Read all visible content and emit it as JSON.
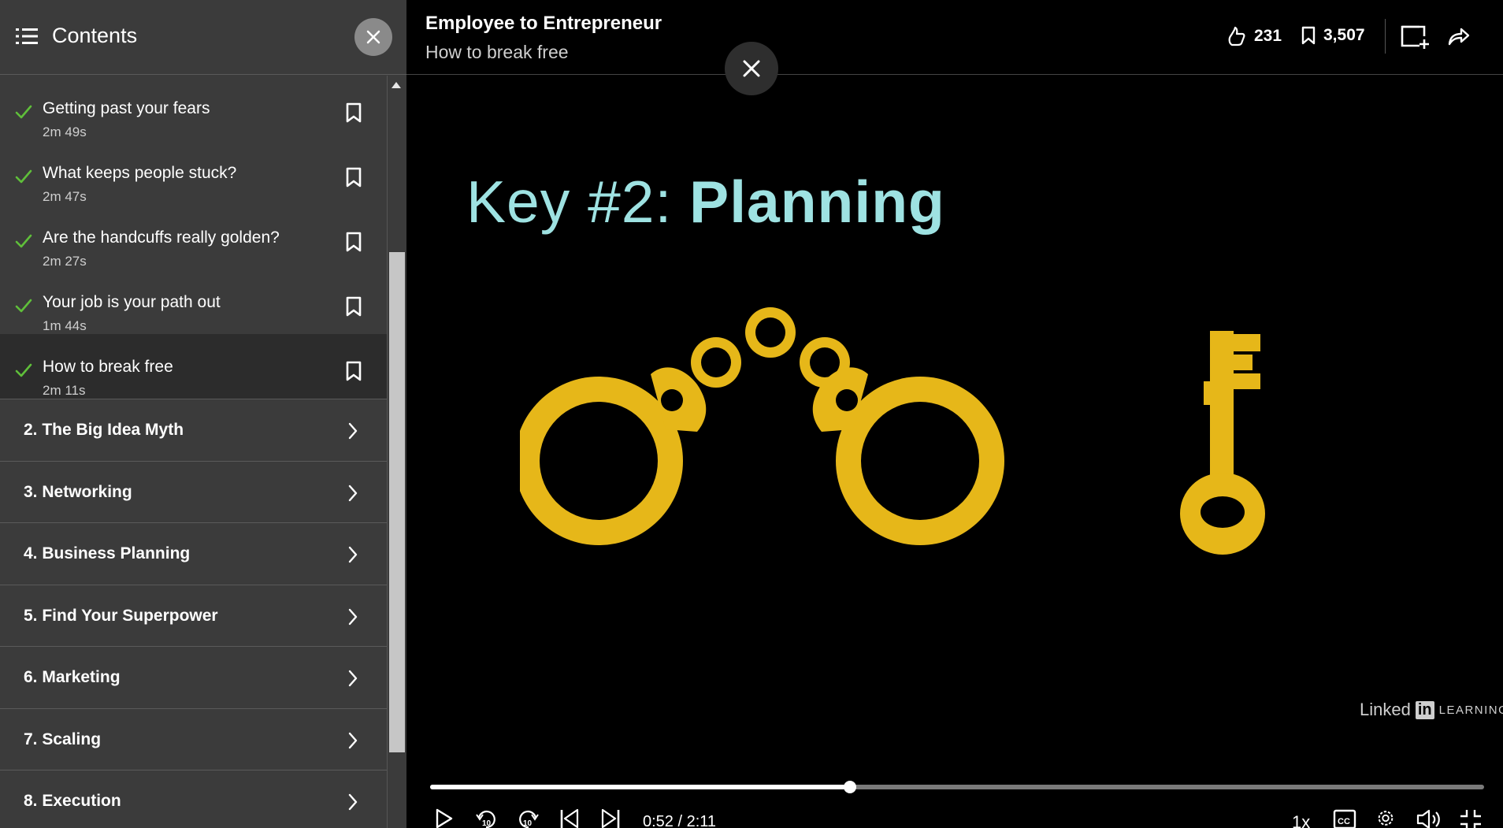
{
  "sidebar": {
    "title": "Contents",
    "videos": [
      {
        "title": "Getting past your fears",
        "duration": "2m 49s",
        "completed": true,
        "active": false
      },
      {
        "title": "What keeps people stuck?",
        "duration": "2m 47s",
        "completed": true,
        "active": false
      },
      {
        "title": "Are the handcuffs really golden?",
        "duration": "2m 27s",
        "completed": true,
        "active": false
      },
      {
        "title": "Your job is your path out",
        "duration": "1m 44s",
        "completed": true,
        "active": false
      },
      {
        "title": "How to break free",
        "duration": "2m 11s",
        "completed": true,
        "active": true
      }
    ],
    "sections": [
      "2. The Big Idea Myth",
      "3. Networking",
      "4. Business Planning",
      "5. Find Your Superpower",
      "6. Marketing",
      "7. Scaling",
      "8. Execution"
    ]
  },
  "header": {
    "course_title": "Employee to Entrepreneur",
    "video_title": "How to break free",
    "likes": "231",
    "saves": "3,507"
  },
  "slide": {
    "title_prefix": "Key #2: ",
    "title_emphasis": "Planning",
    "watermark_brand": "Linked",
    "watermark_in": "in",
    "watermark_product": "LEARNING"
  },
  "player": {
    "time": "0:52 / 2:11",
    "progress": 0.398,
    "speed": "1x"
  },
  "colors": {
    "accent_check": "#5fbf3a",
    "slide_text": "#9ee2e2",
    "art_gold": "#e6b719"
  }
}
